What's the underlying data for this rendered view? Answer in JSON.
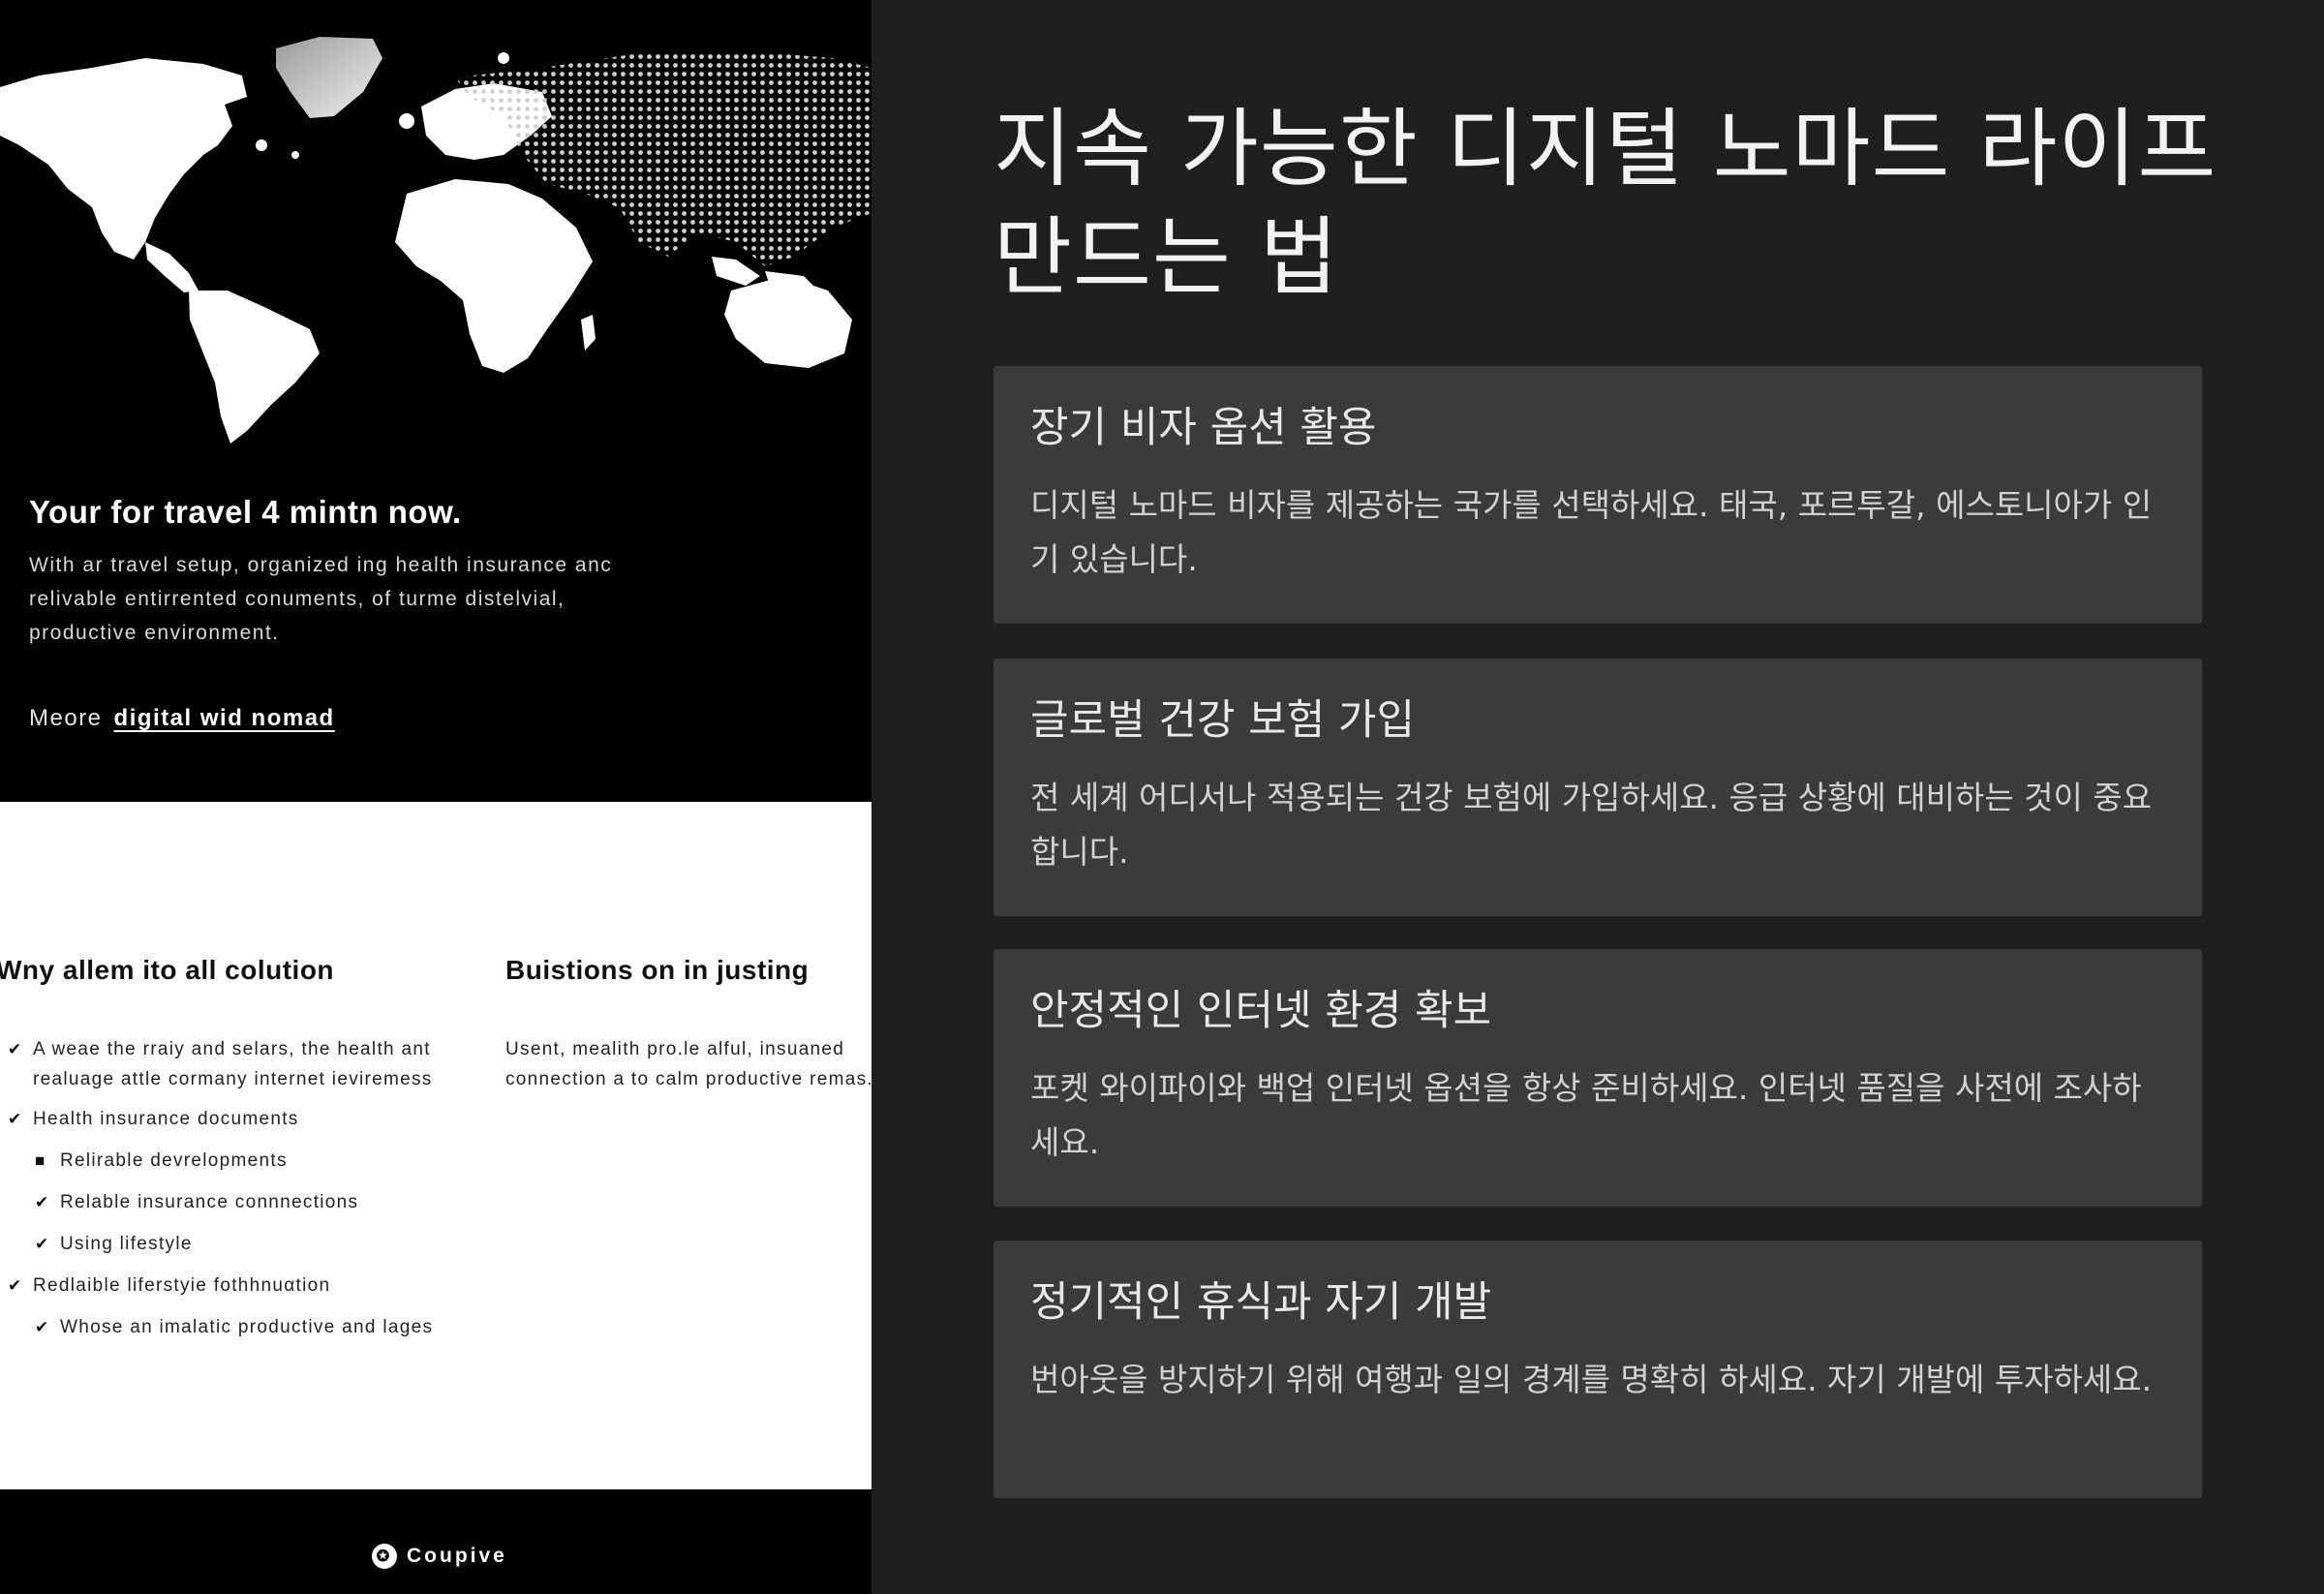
{
  "left_panel": {
    "hero": {
      "title": "Your for travel 4 mintn now.",
      "description": "With ar travel setup, organized ing health insurance anc relivable entirrented conuments, of turme distelvial, productive environment.",
      "more_prefix": "Meore",
      "more_link": "digital wid nomad"
    },
    "column1": {
      "heading": "Wny allem ito all colution",
      "items": [
        {
          "text": "A weae the rraiy and selars, the health ant realuage attle cormany internet ieviremess",
          "level": 0,
          "mark": "✔"
        },
        {
          "text": "Health insurance documents",
          "level": 0,
          "mark": "✔"
        },
        {
          "text": "Relirable devrelopments",
          "level": 1,
          "mark": "■"
        },
        {
          "text": "Relable insurance connnections",
          "level": 1,
          "mark": "✔"
        },
        {
          "text": "Using lifestyle",
          "level": 1,
          "mark": "✔"
        },
        {
          "text": "Redlaible liferstyie fothhnuαtion",
          "level": 0,
          "mark": "✔"
        },
        {
          "text": "Whose an imalatic productive and lages",
          "level": 1,
          "mark": "✔"
        }
      ]
    },
    "column2": {
      "heading": "Buistions on in justing",
      "description": "Usent, mealith pro.le alful, insuaned connection a to calm productive remas."
    },
    "footer": {
      "brand": "Coupive",
      "logo_icon": "compass-icon"
    }
  },
  "right_panel": {
    "title": "지속 가능한 디지털 노마드 라이프 만드는 법",
    "cards": [
      {
        "title": "장기 비자 옵션 활용",
        "body": "디지털 노마드 비자를 제공하는 국가를 선택하세요. 태국, 포르투갈, 에스토니아가 인기 있습니다."
      },
      {
        "title": "글로벌 건강 보험 가입",
        "body": "전 세계 어디서나 적용되는 건강 보험에 가입하세요. 응급 상황에 대비하는 것이 중요합니다."
      },
      {
        "title": "안정적인 인터넷 환경 확보",
        "body": "포켓 와이파이와 백업 인터넷 옵션을 항상 준비하세요. 인터넷 품질을 사전에 조사하세요."
      },
      {
        "title": "정기적인 휴식과 자기 개발",
        "body": "번아웃을 방지하기 위해 여행과 일의 경계를 명확히 하세요. 자기 개발에 투자하세요."
      }
    ]
  },
  "colors": {
    "left_background": "#000000",
    "right_background": "#1f1f1f",
    "card_background": "#3b3b3b",
    "white_section": "#ffffff"
  }
}
